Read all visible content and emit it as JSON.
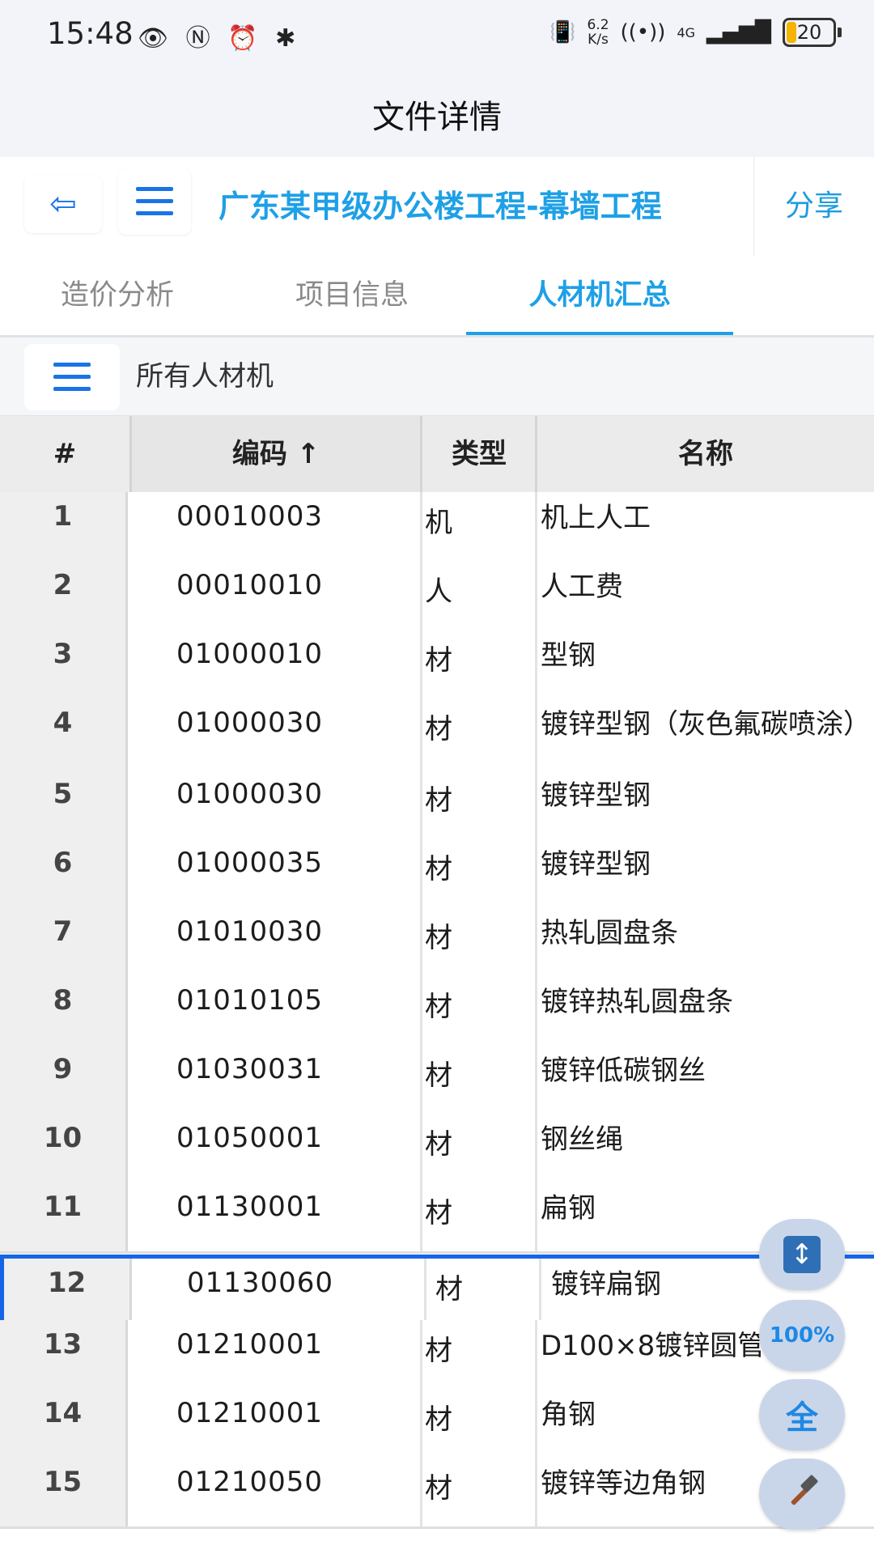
{
  "status_bar": {
    "time": "15:48",
    "left_icons": [
      "eye-icon",
      "nfc-icon",
      "alarm-icon",
      "bluetooth-icon"
    ],
    "net_speed_value": "6.2",
    "net_speed_unit": "K/s",
    "network": "4G",
    "battery": "20"
  },
  "header": {
    "title": "文件详情"
  },
  "toolbar": {
    "back_label": "⇦",
    "project_title": "广东某甲级办公楼工程-幕墙工程",
    "share_label": "分享"
  },
  "tabs": [
    {
      "label": "造价分析",
      "active": false
    },
    {
      "label": "项目信息",
      "active": false
    },
    {
      "label": "人材机汇总",
      "active": true
    }
  ],
  "filter": {
    "label": "所有人材机"
  },
  "table": {
    "columns": [
      "#",
      "编码 ↑",
      "类型",
      "名称"
    ],
    "rows": [
      {
        "n": "1",
        "code": "00010003",
        "type": "机",
        "name": "机上人工"
      },
      {
        "n": "2",
        "code": "00010010",
        "type": "人",
        "name": "人工费"
      },
      {
        "n": "3",
        "code": "01000010",
        "type": "材",
        "name": "型钢"
      },
      {
        "n": "4",
        "code": "01000030",
        "type": "材",
        "name": "镀锌型钢（灰色氟碳喷涂）"
      },
      {
        "n": "5",
        "code": "01000030",
        "type": "材",
        "name": "镀锌型钢"
      },
      {
        "n": "6",
        "code": "01000035",
        "type": "材",
        "name": "镀锌型钢"
      },
      {
        "n": "7",
        "code": "01010030",
        "type": "材",
        "name": "热轧圆盘条"
      },
      {
        "n": "8",
        "code": "01010105",
        "type": "材",
        "name": "镀锌热轧圆盘条"
      },
      {
        "n": "9",
        "code": "01030031",
        "type": "材",
        "name": "镀锌低碳钢丝"
      },
      {
        "n": "10",
        "code": "01050001",
        "type": "材",
        "name": "钢丝绳"
      },
      {
        "n": "11",
        "code": "01130001",
        "type": "材",
        "name": "扁钢"
      },
      {
        "n": "12",
        "code": "01130060",
        "type": "材",
        "name": "镀锌扁钢",
        "selected": true
      },
      {
        "n": "13",
        "code": "01210001",
        "type": "材",
        "name": "D100×8镀锌圆管"
      },
      {
        "n": "14",
        "code": "01210001",
        "type": "材",
        "name": "角钢"
      },
      {
        "n": "15",
        "code": "01210050",
        "type": "材",
        "name": "镀锌等边角钢"
      }
    ]
  },
  "fabs": {
    "expand_icon": "expand-vertical-icon",
    "zoom_label": "100%",
    "all_label": "全",
    "tools_icon": "hammer-icon"
  }
}
